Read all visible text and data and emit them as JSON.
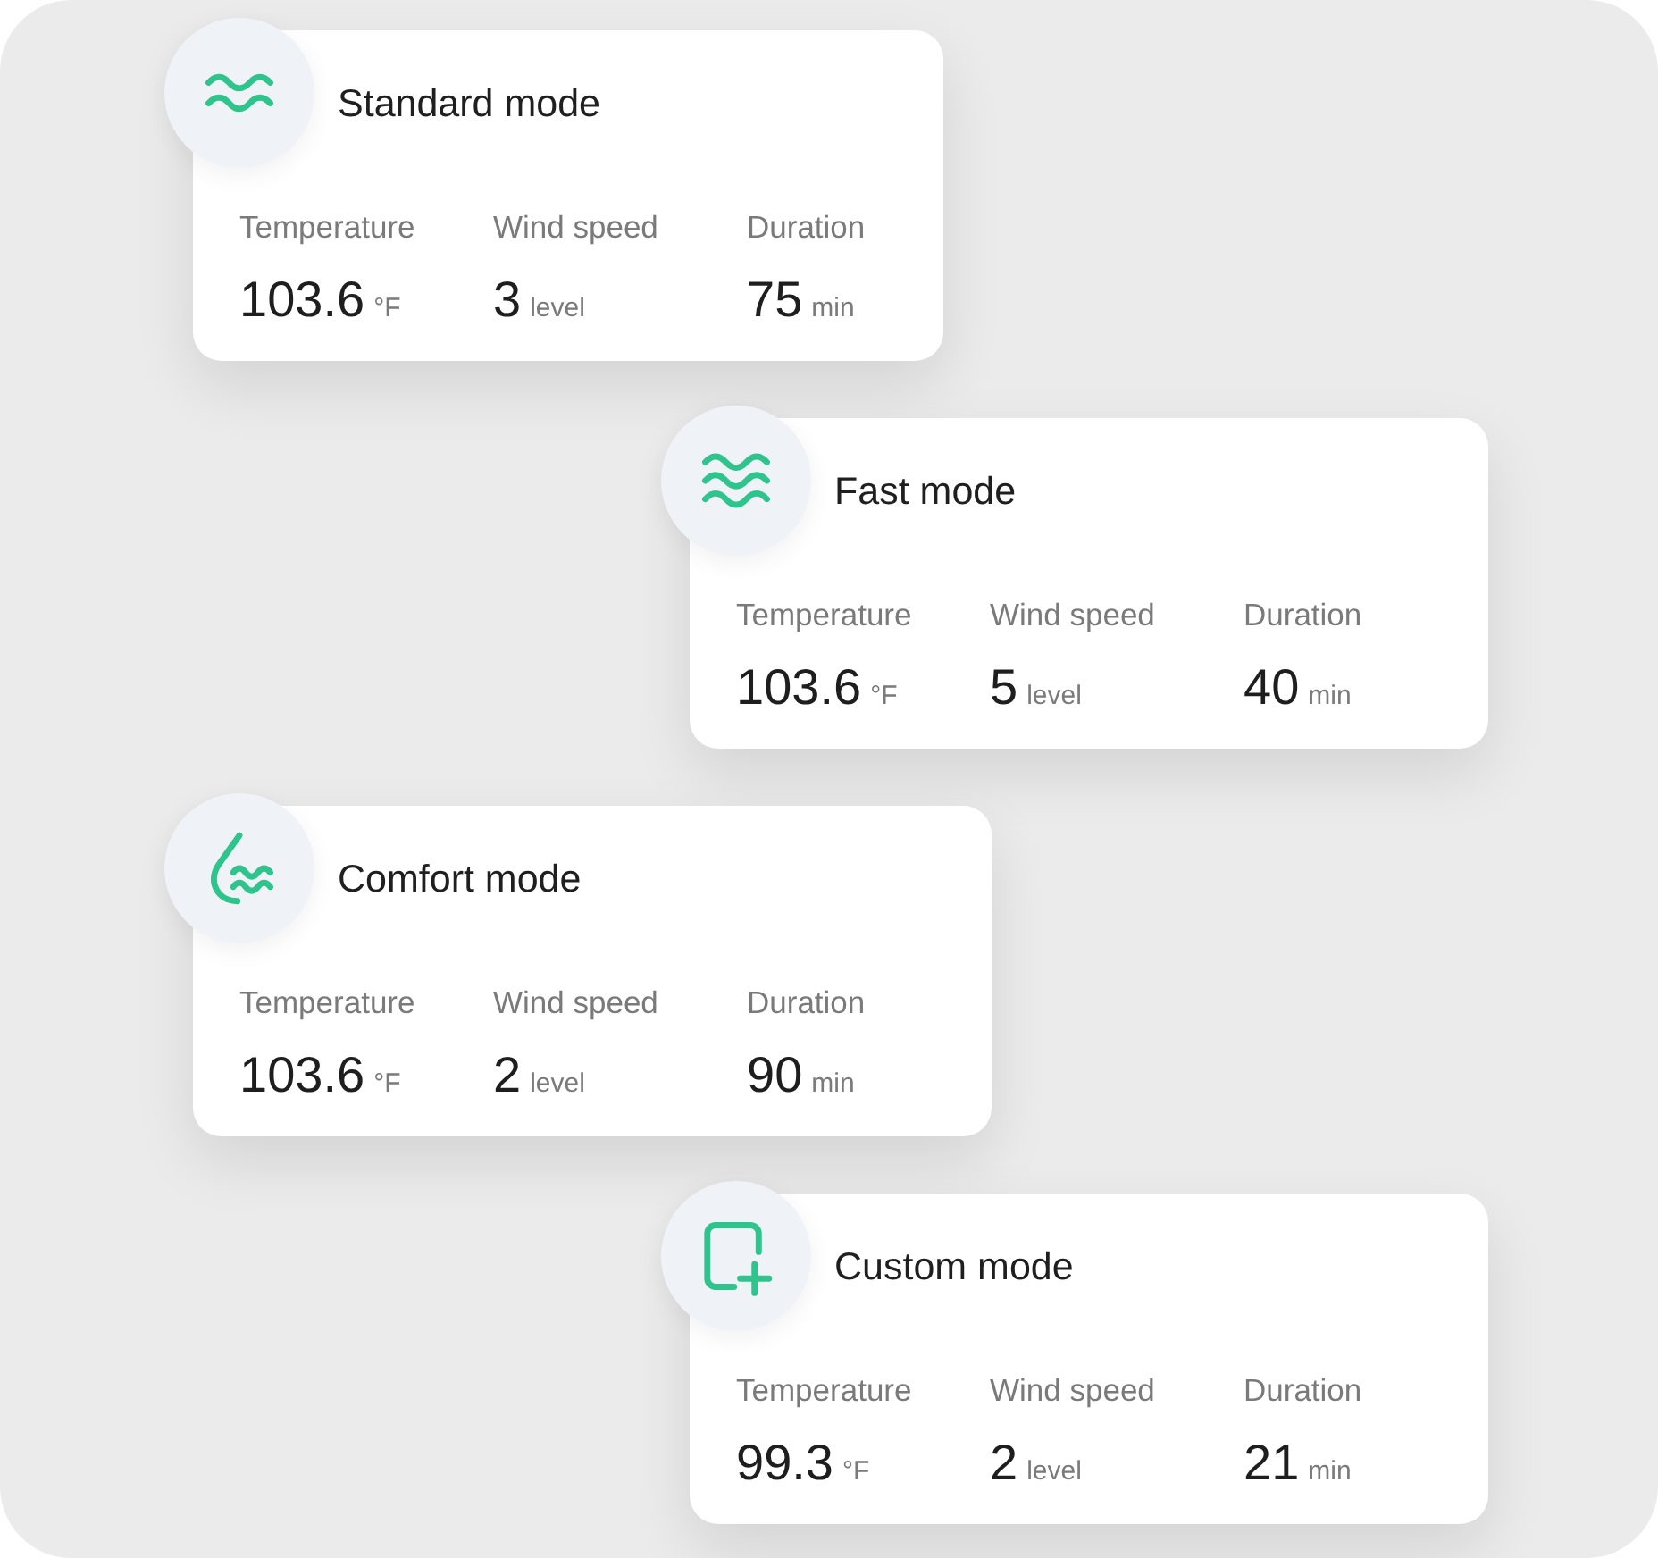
{
  "modes": [
    {
      "kind": "standard",
      "title": "Standard mode",
      "stats": [
        {
          "label": "Temperature",
          "value": "103.6",
          "unit": "°F"
        },
        {
          "label": "Wind speed",
          "value": "3",
          "unit": "level"
        },
        {
          "label": "Duration",
          "value": "75",
          "unit": "min"
        }
      ]
    },
    {
      "kind": "fast",
      "title": "Fast mode",
      "stats": [
        {
          "label": "Temperature",
          "value": "103.6",
          "unit": "°F"
        },
        {
          "label": "Wind speed",
          "value": "5",
          "unit": "level"
        },
        {
          "label": "Duration",
          "value": "40",
          "unit": "min"
        }
      ]
    },
    {
      "kind": "comfort",
      "title": "Comfort mode",
      "stats": [
        {
          "label": "Temperature",
          "value": "103.6",
          "unit": "°F"
        },
        {
          "label": "Wind speed",
          "value": "2",
          "unit": "level"
        },
        {
          "label": "Duration",
          "value": "90",
          "unit": "min"
        }
      ]
    },
    {
      "kind": "custom",
      "title": "Custom mode",
      "stats": [
        {
          "label": "Temperature",
          "value": "99.3",
          "unit": "°F"
        },
        {
          "label": "Wind speed",
          "value": "2",
          "unit": "level"
        },
        {
          "label": "Duration",
          "value": "21",
          "unit": "min"
        }
      ]
    }
  ]
}
